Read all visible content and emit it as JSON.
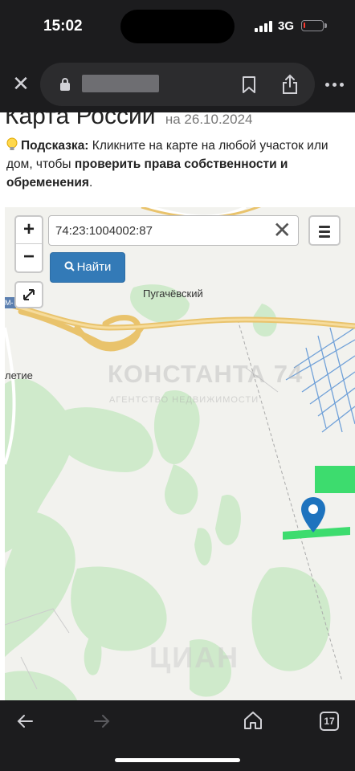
{
  "status_bar": {
    "time": "15:02",
    "network": "3G",
    "battery_level": 0.1
  },
  "browser": {
    "close_icon": "close-icon",
    "lock_icon": "lock-icon",
    "bookmark_icon": "bookmark-icon",
    "share_icon": "share-icon",
    "more_icon": "more-icon"
  },
  "page": {
    "heading": "Карта России",
    "heading_date": "на 26.10.2024",
    "hint_prefix": "Подсказка:",
    "hint_text": " Кликните на карте на любой участок или дом, чтобы ",
    "hint_bold": "проверить права собственности и обременения",
    "hint_end": "."
  },
  "map": {
    "zoom_in": "+",
    "zoom_out": "−",
    "search_value": "74:23:1004002:87",
    "find_label": "Найти",
    "place_pugachevsky": "Пугачёвский",
    "place_partial": "летие",
    "road_badge": "М-",
    "watermark_title": "КОНСТАНТА 74",
    "watermark_sub": "АГЕНТСТВО НЕДВИЖИМОСТИ",
    "watermark_cian": "ЦИАН",
    "colors": {
      "parcel_green": "#3ddc6e",
      "forest_green": "#cfeacb",
      "pin_blue": "#1e73be",
      "button_blue": "#337ab7"
    }
  },
  "toolbar": {
    "tabs_count": "17"
  }
}
